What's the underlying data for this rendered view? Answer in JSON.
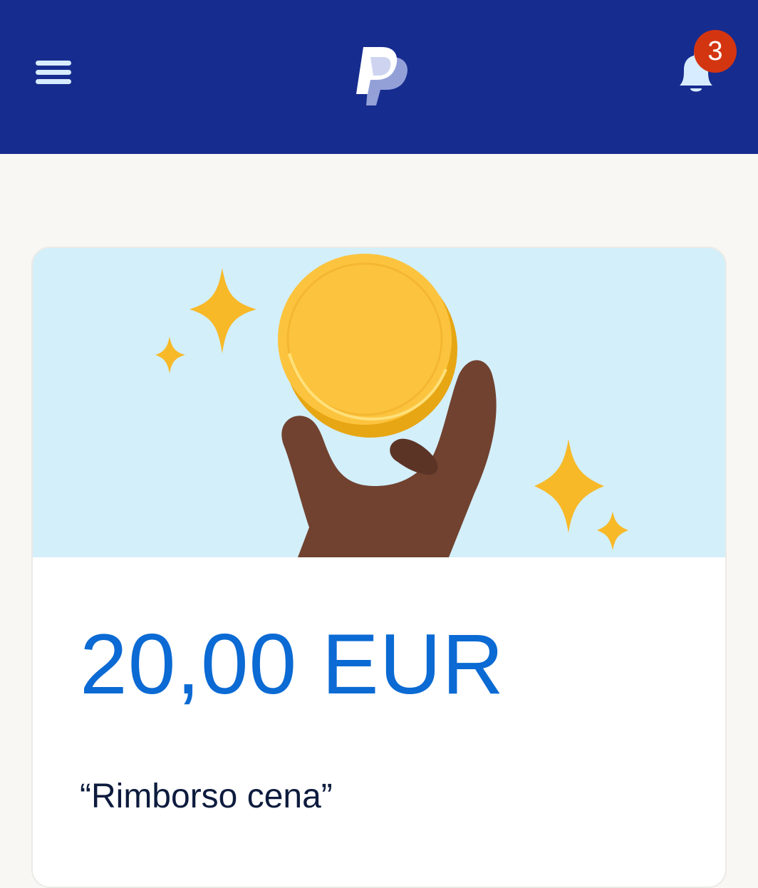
{
  "header": {
    "menu_icon": "hamburger-menu-icon",
    "logo_icon": "paypal-logo-icon",
    "notifications_icon": "bell-icon",
    "notification_count": "3",
    "background_color": "#162c8f",
    "badge_color": "#d43511"
  },
  "card": {
    "illustration": "hand-holding-coin-with-sparkles",
    "amount": "20,00 EUR",
    "note": "“Rimborso cena”",
    "amount_color": "#0b6ad3",
    "illustration_background": "#d3effa"
  }
}
